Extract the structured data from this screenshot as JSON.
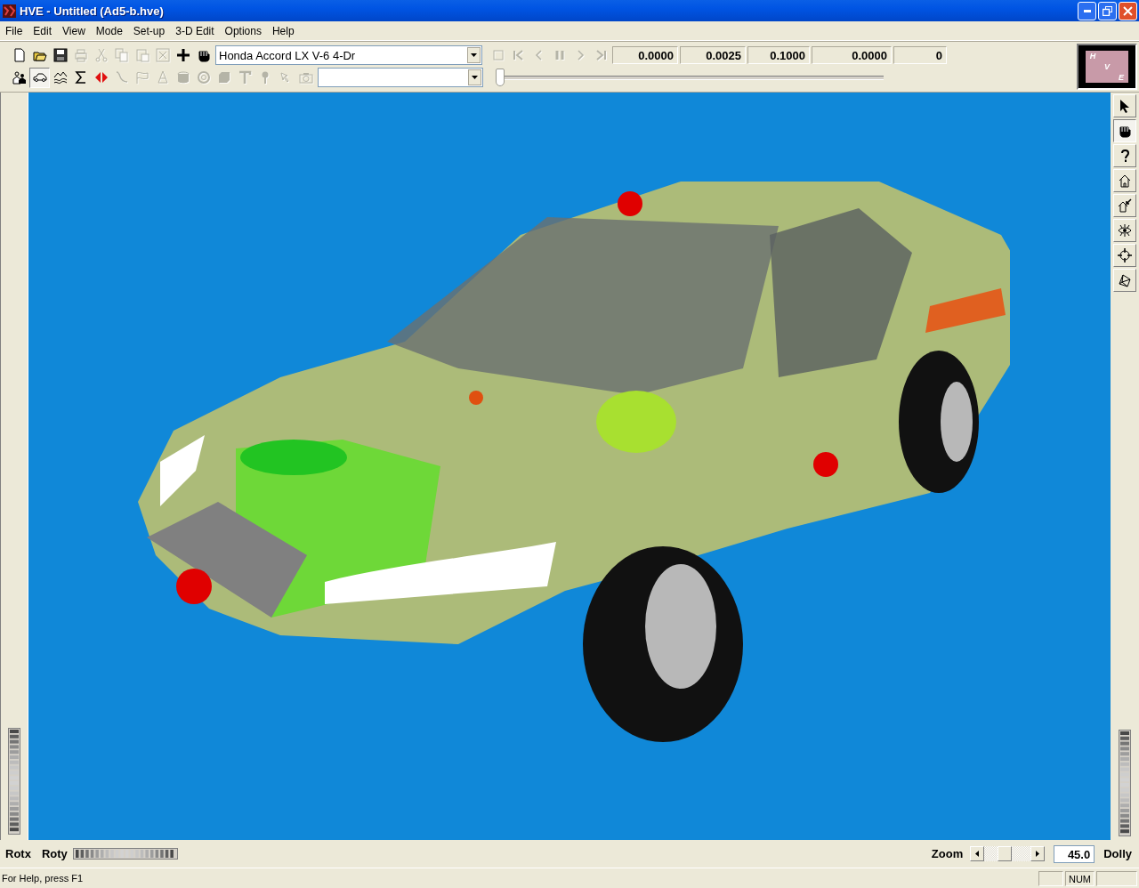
{
  "window": {
    "title": "HVE - Untitled (Ad5-b.hve)"
  },
  "menu": [
    "File",
    "Edit",
    "View",
    "Mode",
    "Set-up",
    "3-D Edit",
    "Options",
    "Help"
  ],
  "toolbar": {
    "row1": [
      {
        "kind": "new",
        "disabled": false,
        "selected": false
      },
      {
        "kind": "open",
        "disabled": false,
        "selected": false
      },
      {
        "kind": "save",
        "disabled": false,
        "selected": false
      },
      {
        "kind": "print",
        "disabled": true,
        "selected": false
      },
      {
        "kind": "cut",
        "disabled": true,
        "selected": false
      },
      {
        "kind": "copy",
        "disabled": true,
        "selected": false
      },
      {
        "kind": "paste",
        "disabled": true,
        "selected": false
      },
      {
        "kind": "xbox",
        "disabled": true,
        "selected": false
      },
      {
        "kind": "plus",
        "disabled": false,
        "selected": false
      },
      {
        "kind": "hand",
        "disabled": false,
        "selected": false
      }
    ],
    "vehicle_select": {
      "value": "Honda Accord LX V-6 4-Dr"
    },
    "row2": [
      {
        "kind": "people",
        "disabled": false,
        "selected": false
      },
      {
        "kind": "car",
        "disabled": false,
        "selected": true
      },
      {
        "kind": "terrain",
        "disabled": false,
        "selected": false
      },
      {
        "kind": "sigma",
        "disabled": false,
        "selected": false
      },
      {
        "kind": "arrows",
        "disabled": false,
        "selected": false
      },
      {
        "kind": "path",
        "disabled": true,
        "selected": false
      },
      {
        "kind": "flag",
        "disabled": true,
        "selected": false
      },
      {
        "kind": "cone",
        "disabled": true,
        "selected": false
      },
      {
        "kind": "drum",
        "disabled": true,
        "selected": false
      },
      {
        "kind": "ring",
        "disabled": true,
        "selected": false
      },
      {
        "kind": "block",
        "disabled": true,
        "selected": false
      },
      {
        "kind": "tee",
        "disabled": true,
        "selected": false
      },
      {
        "kind": "pin",
        "disabled": true,
        "selected": false
      },
      {
        "kind": "pointer",
        "disabled": true,
        "selected": false
      },
      {
        "kind": "camera",
        "disabled": true,
        "selected": false
      }
    ],
    "playback": [
      {
        "kind": "stop",
        "disabled": true
      },
      {
        "kind": "first",
        "disabled": true
      },
      {
        "kind": "prev",
        "disabled": true
      },
      {
        "kind": "pause",
        "disabled": true
      },
      {
        "kind": "next",
        "disabled": true
      },
      {
        "kind": "last",
        "disabled": true
      }
    ],
    "readouts": [
      "0.0000",
      "0.0025",
      "0.1000",
      "0.0000",
      "0"
    ],
    "time_slider": {
      "level": 0
    },
    "logo": [
      "H",
      "V",
      "E"
    ]
  },
  "view_tools": [
    {
      "kind": "arrow",
      "selected": false
    },
    {
      "kind": "hand",
      "selected": true
    },
    {
      "kind": "help",
      "selected": false
    },
    {
      "kind": "house",
      "selected": false
    },
    {
      "kind": "house-arrow",
      "selected": false
    },
    {
      "kind": "eye",
      "selected": false
    },
    {
      "kind": "crosshair",
      "selected": false
    },
    {
      "kind": "cube",
      "selected": false
    }
  ],
  "bottom_bar": {
    "rotx_label": "Rotx",
    "roty_label": "Roty",
    "zoom_label": "Zoom",
    "zoom_slider": {
      "level": 0.42
    },
    "zoom_value": "45.0",
    "dolly_label": "Dolly"
  },
  "status_bar": {
    "message": "For Help, press F1",
    "indicators": [
      "NUM"
    ]
  }
}
